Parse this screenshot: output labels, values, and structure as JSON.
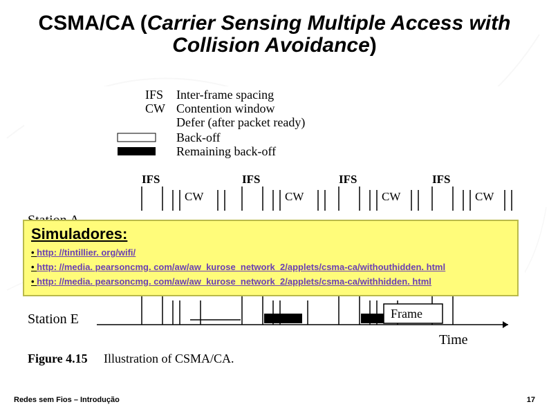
{
  "title": {
    "plain_prefix": "CSMA/CA (",
    "italic": "Carrier Sensing Multiple Access with Collision Avoidance",
    "plain_suffix": ")"
  },
  "diagram": {
    "legend": {
      "IFS": "Inter-frame spacing",
      "CW": "Contention window",
      "defer": "Defer (after packet ready)",
      "backoff": "Back-off",
      "remaining": "Remaining back-off"
    },
    "headers": {
      "ifs": "IFS",
      "cw": "CW"
    },
    "stations": [
      "Station A",
      "Station E"
    ],
    "frame_label": "Frame",
    "time_label": "Time",
    "figure_label": "Figure 4.15",
    "figure_caption": "Illustration of CSMA/CA."
  },
  "simulators": {
    "heading": "Simuladores:",
    "links": [
      "http: //tintillier. org/wifi/",
      "http: //media. pearsoncmg. com/aw/aw_kurose_network_2/applets/csma-ca/withouthidden. html",
      "http: //media. pearsoncmg. com/aw/aw_kurose_network_2/applets/csma-ca/withhidden. html"
    ]
  },
  "footer": {
    "left": "Redes sem Fios – Introdução",
    "right": "17"
  }
}
